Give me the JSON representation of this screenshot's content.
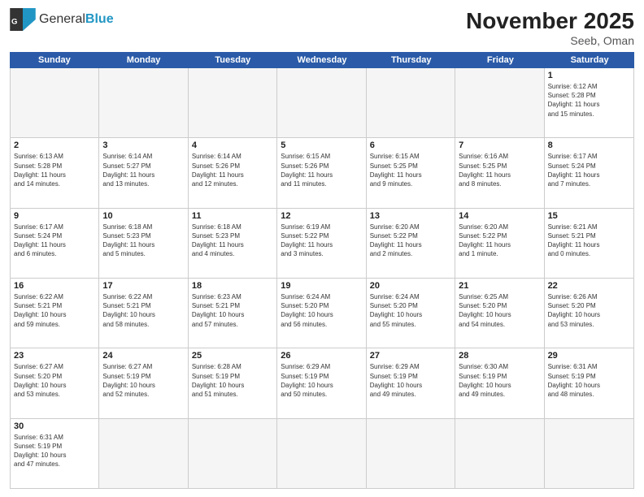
{
  "header": {
    "logo_general": "General",
    "logo_blue": "Blue",
    "month_title": "November 2025",
    "location": "Seeb, Oman"
  },
  "day_headers": [
    "Sunday",
    "Monday",
    "Tuesday",
    "Wednesday",
    "Thursday",
    "Friday",
    "Saturday"
  ],
  "weeks": [
    {
      "days": [
        {
          "num": "",
          "text": ""
        },
        {
          "num": "",
          "text": ""
        },
        {
          "num": "",
          "text": ""
        },
        {
          "num": "",
          "text": ""
        },
        {
          "num": "",
          "text": ""
        },
        {
          "num": "",
          "text": ""
        },
        {
          "num": "1",
          "text": "Sunrise: 6:12 AM\nSunset: 5:28 PM\nDaylight: 11 hours\nand 15 minutes."
        }
      ]
    },
    {
      "days": [
        {
          "num": "2",
          "text": "Sunrise: 6:13 AM\nSunset: 5:28 PM\nDaylight: 11 hours\nand 14 minutes."
        },
        {
          "num": "3",
          "text": "Sunrise: 6:14 AM\nSunset: 5:27 PM\nDaylight: 11 hours\nand 13 minutes."
        },
        {
          "num": "4",
          "text": "Sunrise: 6:14 AM\nSunset: 5:26 PM\nDaylight: 11 hours\nand 12 minutes."
        },
        {
          "num": "5",
          "text": "Sunrise: 6:15 AM\nSunset: 5:26 PM\nDaylight: 11 hours\nand 11 minutes."
        },
        {
          "num": "6",
          "text": "Sunrise: 6:15 AM\nSunset: 5:25 PM\nDaylight: 11 hours\nand 9 minutes."
        },
        {
          "num": "7",
          "text": "Sunrise: 6:16 AM\nSunset: 5:25 PM\nDaylight: 11 hours\nand 8 minutes."
        },
        {
          "num": "8",
          "text": "Sunrise: 6:17 AM\nSunset: 5:24 PM\nDaylight: 11 hours\nand 7 minutes."
        }
      ]
    },
    {
      "days": [
        {
          "num": "9",
          "text": "Sunrise: 6:17 AM\nSunset: 5:24 PM\nDaylight: 11 hours\nand 6 minutes."
        },
        {
          "num": "10",
          "text": "Sunrise: 6:18 AM\nSunset: 5:23 PM\nDaylight: 11 hours\nand 5 minutes."
        },
        {
          "num": "11",
          "text": "Sunrise: 6:18 AM\nSunset: 5:23 PM\nDaylight: 11 hours\nand 4 minutes."
        },
        {
          "num": "12",
          "text": "Sunrise: 6:19 AM\nSunset: 5:22 PM\nDaylight: 11 hours\nand 3 minutes."
        },
        {
          "num": "13",
          "text": "Sunrise: 6:20 AM\nSunset: 5:22 PM\nDaylight: 11 hours\nand 2 minutes."
        },
        {
          "num": "14",
          "text": "Sunrise: 6:20 AM\nSunset: 5:22 PM\nDaylight: 11 hours\nand 1 minute."
        },
        {
          "num": "15",
          "text": "Sunrise: 6:21 AM\nSunset: 5:21 PM\nDaylight: 11 hours\nand 0 minutes."
        }
      ]
    },
    {
      "days": [
        {
          "num": "16",
          "text": "Sunrise: 6:22 AM\nSunset: 5:21 PM\nDaylight: 10 hours\nand 59 minutes."
        },
        {
          "num": "17",
          "text": "Sunrise: 6:22 AM\nSunset: 5:21 PM\nDaylight: 10 hours\nand 58 minutes."
        },
        {
          "num": "18",
          "text": "Sunrise: 6:23 AM\nSunset: 5:21 PM\nDaylight: 10 hours\nand 57 minutes."
        },
        {
          "num": "19",
          "text": "Sunrise: 6:24 AM\nSunset: 5:20 PM\nDaylight: 10 hours\nand 56 minutes."
        },
        {
          "num": "20",
          "text": "Sunrise: 6:24 AM\nSunset: 5:20 PM\nDaylight: 10 hours\nand 55 minutes."
        },
        {
          "num": "21",
          "text": "Sunrise: 6:25 AM\nSunset: 5:20 PM\nDaylight: 10 hours\nand 54 minutes."
        },
        {
          "num": "22",
          "text": "Sunrise: 6:26 AM\nSunset: 5:20 PM\nDaylight: 10 hours\nand 53 minutes."
        }
      ]
    },
    {
      "days": [
        {
          "num": "23",
          "text": "Sunrise: 6:27 AM\nSunset: 5:20 PM\nDaylight: 10 hours\nand 53 minutes."
        },
        {
          "num": "24",
          "text": "Sunrise: 6:27 AM\nSunset: 5:19 PM\nDaylight: 10 hours\nand 52 minutes."
        },
        {
          "num": "25",
          "text": "Sunrise: 6:28 AM\nSunset: 5:19 PM\nDaylight: 10 hours\nand 51 minutes."
        },
        {
          "num": "26",
          "text": "Sunrise: 6:29 AM\nSunset: 5:19 PM\nDaylight: 10 hours\nand 50 minutes."
        },
        {
          "num": "27",
          "text": "Sunrise: 6:29 AM\nSunset: 5:19 PM\nDaylight: 10 hours\nand 49 minutes."
        },
        {
          "num": "28",
          "text": "Sunrise: 6:30 AM\nSunset: 5:19 PM\nDaylight: 10 hours\nand 49 minutes."
        },
        {
          "num": "29",
          "text": "Sunrise: 6:31 AM\nSunset: 5:19 PM\nDaylight: 10 hours\nand 48 minutes."
        }
      ]
    },
    {
      "days": [
        {
          "num": "30",
          "text": "Sunrise: 6:31 AM\nSunset: 5:19 PM\nDaylight: 10 hours\nand 47 minutes."
        },
        {
          "num": "",
          "text": ""
        },
        {
          "num": "",
          "text": ""
        },
        {
          "num": "",
          "text": ""
        },
        {
          "num": "",
          "text": ""
        },
        {
          "num": "",
          "text": ""
        },
        {
          "num": "",
          "text": ""
        }
      ]
    }
  ]
}
